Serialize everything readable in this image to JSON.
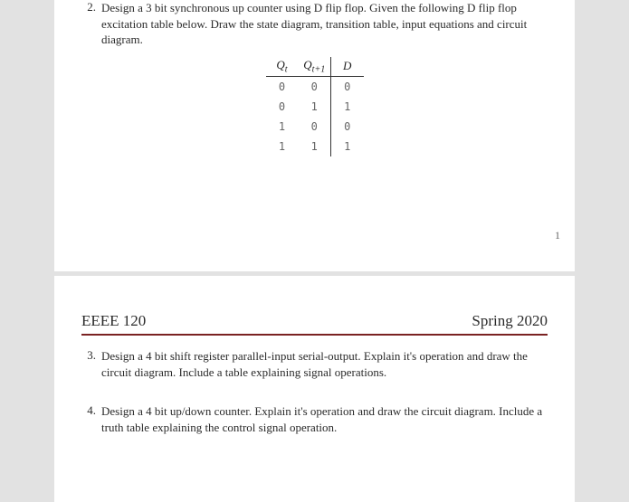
{
  "page1": {
    "q2": {
      "num": "2.",
      "text": "Design a 3 bit synchronous up counter using D flip flop. Given the following D flip flop excitation table below. Draw the state diagram, transition table, input equations and circuit diagram."
    },
    "table": {
      "headers": {
        "h1": "Q",
        "h1sub": "t",
        "h2": "Q",
        "h2sub": "t+1",
        "h3": "D"
      },
      "rows": [
        {
          "c1": "0",
          "c2": "0",
          "c3": "0"
        },
        {
          "c1": "0",
          "c2": "1",
          "c3": "1"
        },
        {
          "c1": "1",
          "c2": "0",
          "c3": "0"
        },
        {
          "c1": "1",
          "c2": "1",
          "c3": "1"
        }
      ]
    },
    "pageNumber": "1"
  },
  "page2": {
    "course": "EEEE 120",
    "term": "Spring 2020",
    "q3": {
      "num": "3.",
      "text": "Design a 4 bit shift register parallel-input serial-output. Explain it's operation and draw the circuit diagram. Include a table explaining signal operations."
    },
    "q4": {
      "num": "4.",
      "text": "Design a 4 bit up/down counter. Explain it's operation and draw the circuit diagram. Include a truth table explaining the control signal operation."
    }
  }
}
